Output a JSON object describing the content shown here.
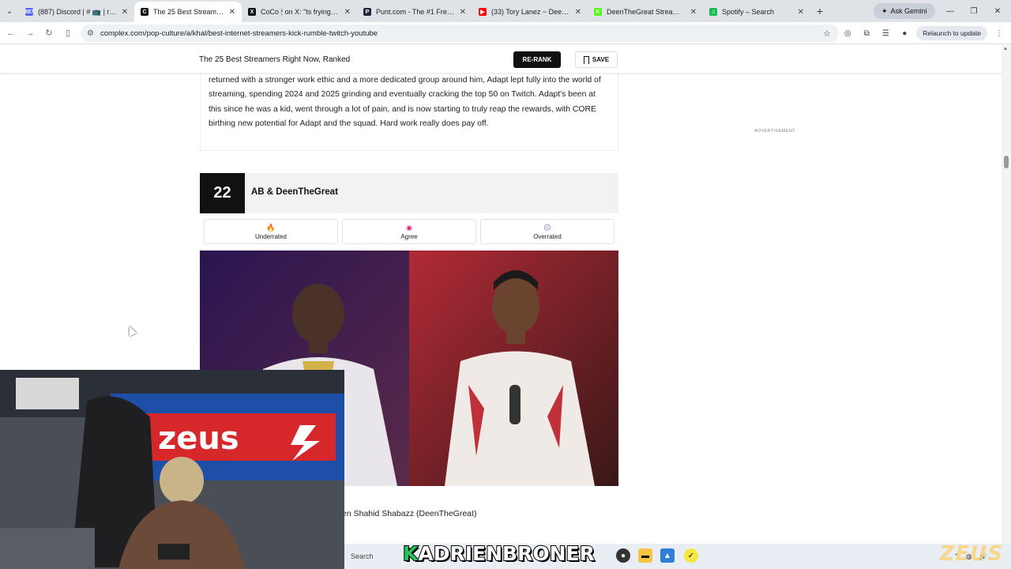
{
  "browser": {
    "tabs": [
      {
        "label": "(887) Discord | # 📺 | reactio",
        "favicon_color": "#5865f2",
        "favicon_text": "887"
      },
      {
        "label": "The 25 Best Streamers Right",
        "favicon_color": "#111111",
        "favicon_text": "C",
        "active": true
      },
      {
        "label": "CoCo 🕯 on X: \"ts frying me",
        "favicon_color": "#111111",
        "favicon_text": "X"
      },
      {
        "label": "Punt.com - The #1 Free to P",
        "favicon_color": "#1f2937",
        "favicon_text": "P"
      },
      {
        "label": "(33) Tory Lanez ~ Deen & A",
        "favicon_color": "#ff0000",
        "favicon_text": "▶"
      },
      {
        "label": "DeenTheGreat Stream - Wa",
        "favicon_color": "#53fc18",
        "favicon_text": "K"
      },
      {
        "label": "Spotify – Search",
        "favicon_color": "#1db954",
        "favicon_text": "♫"
      }
    ],
    "new_tab": "+",
    "ask_gemini": "Ask Gemini",
    "url": "complex.com/pop-culture/a/khal/best-internet-streamers-kick-rumble-twitch-youtube",
    "relaunch": "Relaunch to update"
  },
  "sticky": {
    "title": "The 25 Best Streamers Right Now, Ranked",
    "rerank": "RE-RANK",
    "save": "SAVE"
  },
  "article": {
    "paragraph": "returned with a stronger work ethic and a more dedicated group around him, Adapt lept fully into the world of streaming, spending 2024 and 2025 grinding and eventually cracking the top 50 on Twitch. Adapt's been at this since he was a kid, went through a lot of pain, and is now starting to truly reap the rewards, with CORE birthing new potential for Adapt and the squad. Hard work really does pay off.",
    "advertisement": "ADVERTISEMENT",
    "rank": {
      "number": "22",
      "name": "AB & DeenTheGreat",
      "votes": [
        {
          "label": "Underrated",
          "icon": "fire-icon"
        },
        {
          "label": "Agree",
          "icon": "target-icon"
        },
        {
          "label": "Overrated",
          "icon": "neutral-face-icon"
        }
      ],
      "caption": "en Shahid Shabazz (DeenTheGreat)"
    }
  },
  "taskbar": {
    "search": "Search"
  },
  "overlay": {
    "streamer_k": "K",
    "streamer_rest": "ADRIENBRONER",
    "brand": "ZEUS"
  }
}
